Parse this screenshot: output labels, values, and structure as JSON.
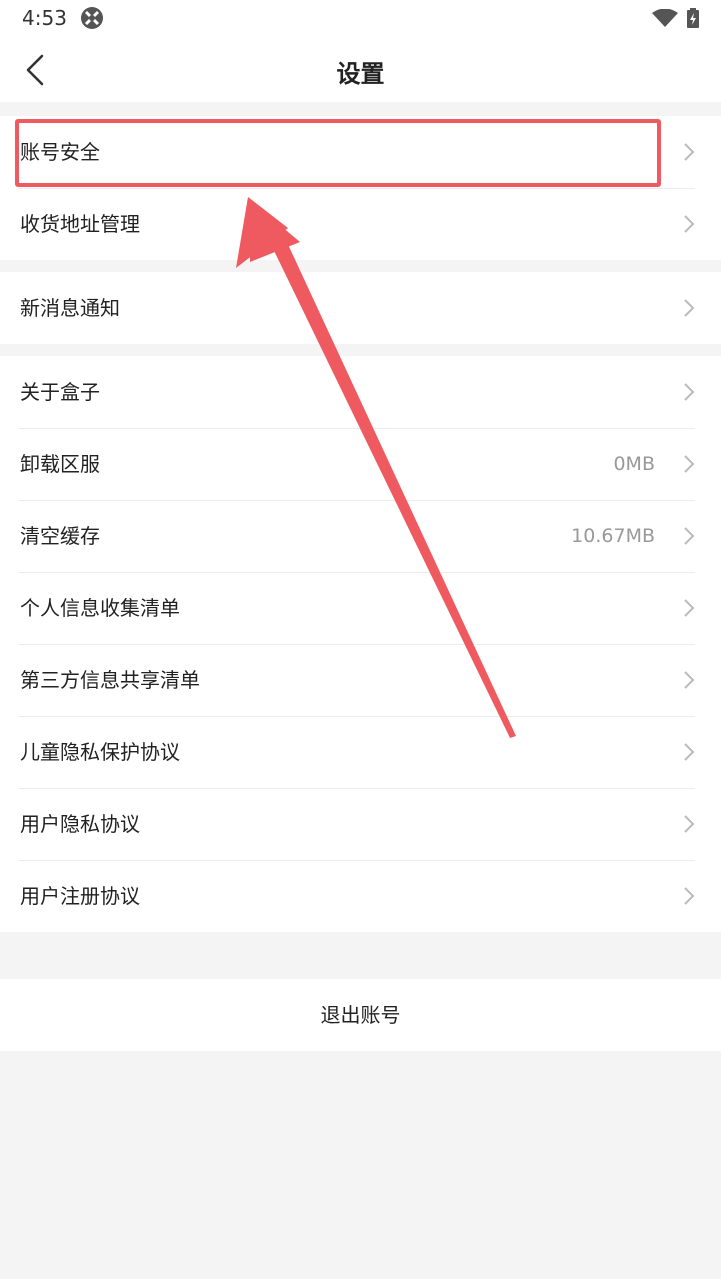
{
  "status_bar": {
    "time": "4:53"
  },
  "nav": {
    "title": "设置"
  },
  "groups": [
    {
      "items": [
        {
          "label": "账号安全",
          "value": ""
        },
        {
          "label": "收货地址管理",
          "value": ""
        }
      ]
    },
    {
      "items": [
        {
          "label": "新消息通知",
          "value": ""
        }
      ]
    },
    {
      "items": [
        {
          "label": "关于盒子",
          "value": ""
        },
        {
          "label": "卸载区服",
          "value": "0MB"
        },
        {
          "label": "清空缓存",
          "value": "10.67MB"
        },
        {
          "label": "个人信息收集清单",
          "value": ""
        },
        {
          "label": "第三方信息共享清单",
          "value": ""
        },
        {
          "label": "儿童隐私保护协议",
          "value": ""
        },
        {
          "label": "用户隐私协议",
          "value": ""
        },
        {
          "label": "用户注册协议",
          "value": ""
        }
      ]
    }
  ],
  "logout": {
    "label": "退出账号"
  },
  "annotation": {
    "color": "#ee5a5f"
  }
}
